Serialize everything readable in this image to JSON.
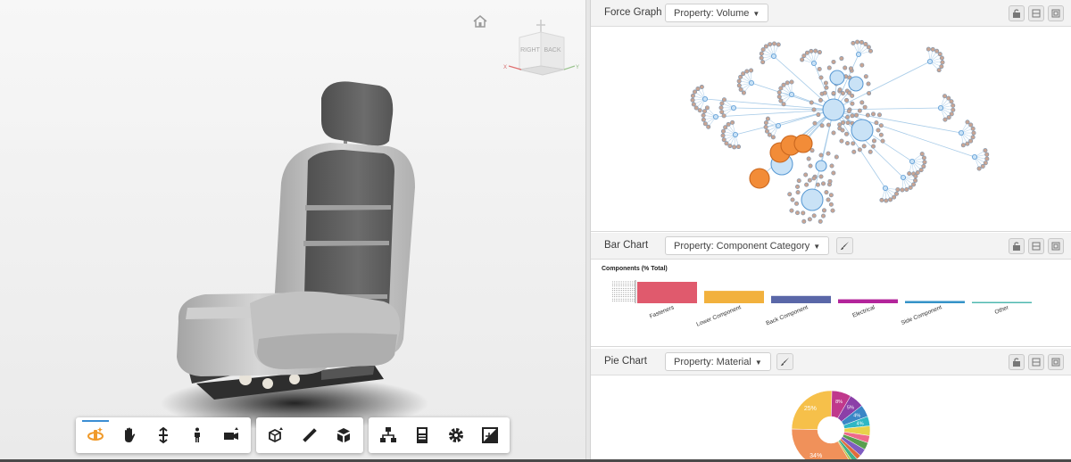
{
  "viewer": {
    "viewcube": {
      "right_label": "RIGHT",
      "back_label": "BACK",
      "x_axis": "X",
      "y_axis": "Y"
    },
    "toolbar": {
      "groups": [
        [
          {
            "name": "orbit-icon",
            "active": true
          },
          {
            "name": "pan-icon"
          },
          {
            "name": "zoom-icon"
          },
          {
            "name": "first-person-icon"
          },
          {
            "name": "camera-icon"
          }
        ],
        [
          {
            "name": "explode-model-icon"
          },
          {
            "name": "measure-icon"
          },
          {
            "name": "section-box-icon"
          }
        ],
        [
          {
            "name": "model-browser-icon"
          },
          {
            "name": "properties-icon"
          },
          {
            "name": "settings-icon"
          },
          {
            "name": "fullscreen-icon"
          }
        ]
      ]
    }
  },
  "panels": {
    "force": {
      "title": "Force Graph",
      "property": "Property: Volume"
    },
    "bar": {
      "title": "Bar Chart",
      "property": "Property: Component Category"
    },
    "pie": {
      "title": "Pie Chart",
      "property": "Property: Material"
    }
  },
  "colors": {
    "node_fill": "#c9e2f6",
    "node_stroke": "#5b9bd5",
    "leaf_fill": "#c8a594",
    "highlight": "#f28c38",
    "accent": "#3b8ed3"
  },
  "chart_data": [
    {
      "type": "bar",
      "title": "Components (% Total)",
      "categories": [
        "Fasteners",
        "Lower Component",
        "Back Component",
        "Electrical",
        "Side Component",
        "Other"
      ],
      "values": [
        38,
        22,
        13,
        7,
        4,
        2
      ],
      "colors": [
        "#e05a6d",
        "#f2b13d",
        "#5a67a8",
        "#b3259b",
        "#3593c8",
        "#4fb8b0"
      ]
    },
    {
      "type": "pie",
      "donut": true,
      "labels": [
        "34%",
        "25%",
        "8%",
        "5%",
        "4%",
        "4%"
      ],
      "values": [
        34,
        25,
        8,
        6,
        5,
        4,
        4,
        3,
        3,
        3,
        2,
        2,
        1
      ],
      "colors": [
        "#f0915a",
        "#f6c04a",
        "#c0388c",
        "#8b3fa8",
        "#3a86c6",
        "#2fb7c4",
        "#e8d24a",
        "#ee6a8a",
        "#5a9e4f",
        "#7f5cc1",
        "#e06c3c",
        "#3fb08a",
        "#b9c24a"
      ]
    }
  ]
}
